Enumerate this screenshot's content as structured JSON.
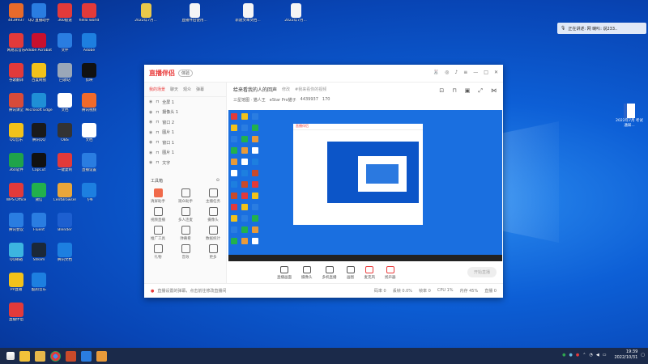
{
  "colors": {
    "accent": "#e93b3b",
    "desktop": "#0d5fd6",
    "taskbar": "#1b2a4a"
  },
  "desktop": {
    "icons_col1": [
      {
        "label": "4439937",
        "color": "#e76a2b"
      },
      {
        "label": "网易云音乐",
        "color": "#e23a3a"
      },
      {
        "label": "谷歌翻译",
        "color": "#e23a3a"
      },
      {
        "label": "腾讯课堂",
        "color": "#d84b3a"
      },
      {
        "label": "QQ音乐",
        "color": "#f2c21a"
      },
      {
        "label": "360软件",
        "color": "#1fa34a"
      },
      {
        "label": "WPS Office",
        "color": "#e23a3a"
      },
      {
        "label": "腾讯会议",
        "color": "#2a7de1"
      },
      {
        "label": "QQ邮箱",
        "color": "#3cb5e0"
      },
      {
        "label": "PP直播",
        "color": "#f2c21a"
      },
      {
        "label": "直播伴侣",
        "color": "#e23a3a"
      }
    ],
    "icons_col2": [
      {
        "label": "QQ 直播助手",
        "color": "#2a7de1"
      },
      {
        "label": "Adobe Acrobat DC",
        "color": "#c8102e"
      },
      {
        "label": "百度网盘",
        "color": "#f2c21a"
      },
      {
        "label": "Microsoft Edge",
        "color": "#1f8fd6"
      },
      {
        "label": "腾讯QQ",
        "color": "#1a1a1a"
      },
      {
        "label": "CapCut",
        "color": "#111"
      },
      {
        "label": "微信",
        "color": "#22b14c"
      },
      {
        "label": "Fluent",
        "color": "#2a7de1"
      },
      {
        "label": "Steam",
        "color": "#1b2838"
      },
      {
        "label": "酷狗音乐",
        "color": "#1d7fe0"
      }
    ],
    "icons_col3": [
      {
        "label": "360极速",
        "color": "#e23a3a"
      },
      {
        "label": "文件",
        "color": "#2a7de1"
      },
      {
        "label": "回收站",
        "color": "#9aa7b8"
      },
      {
        "label": "文档",
        "color": "#ffffff"
      },
      {
        "label": "OBS",
        "color": "#333"
      },
      {
        "label": "一键复制",
        "color": "#e23a3a"
      },
      {
        "label": "CentBrowser",
        "color": "#e9a63a"
      },
      {
        "label": "Blender",
        "color": "#1d5fd0"
      },
      {
        "label": "腾讯文档",
        "color": "#1d7fe0"
      }
    ],
    "icons_col4": [
      {
        "label": "hello world",
        "color": "#e23a3a"
      },
      {
        "label": "Adobe",
        "color": "#1d7fe0"
      },
      {
        "label": "剪映",
        "color": "#111"
      },
      {
        "label": "腾讯视频",
        "color": "#f06a2a"
      },
      {
        "label": "文档",
        "color": "#ffffff"
      },
      {
        "label": "直播设置",
        "color": "#2a7de1"
      },
      {
        "label": "飞书",
        "color": "#1d7fe0"
      }
    ],
    "top_files": [
      {
        "label": "2022年7月..."
      },
      {
        "label": "直播伴侣使用..."
      },
      {
        "label": "新建文本文档..."
      },
      {
        "label": "2022年7月..."
      }
    ],
    "right_doc": "2022年7月 考试通知..."
  },
  "notification": "正在讲述: 网 喇叭: 说233..",
  "app": {
    "logo": "直播伴侣",
    "badge": "体验",
    "left_tabs": [
      "我的场景",
      "聊天",
      "观众",
      "弹幕"
    ],
    "scenes": [
      "全屏 1",
      "摄像头 1",
      "窗口 2",
      "图片 1",
      "窗口 1",
      "图片 1",
      "文字"
    ],
    "tools_title": "工具箱",
    "tools": [
      "清屏助手",
      "观众助手",
      "主播任务",
      "视频直播",
      "多人连麦",
      "摄像头",
      "推广工具",
      "弹幕看",
      "数据统计",
      "礼物",
      "音效",
      "更多"
    ],
    "stream_title": "给来看我的人的回声",
    "stream_edit": "修改",
    "stream_sub": "#我来看你的视频",
    "meta": [
      "三星馆图 · 猫人王",
      "eStar Pro猫子",
      "4439937",
      "170"
    ],
    "controls": [
      "直播画面",
      "摄像头",
      "多机直播",
      "画图",
      "麦克风",
      "扬声器"
    ],
    "live_button": "开始直播",
    "notice": "直播设置的弹幕，点击前往修改直播间",
    "stats": [
      "码率 0",
      "丢帧 0.0%",
      "帧率 0",
      "CPU 1%",
      "内存 45%",
      "直播 0"
    ]
  },
  "taskbar": {
    "time": "19:39",
    "date": "2022/10/31"
  }
}
